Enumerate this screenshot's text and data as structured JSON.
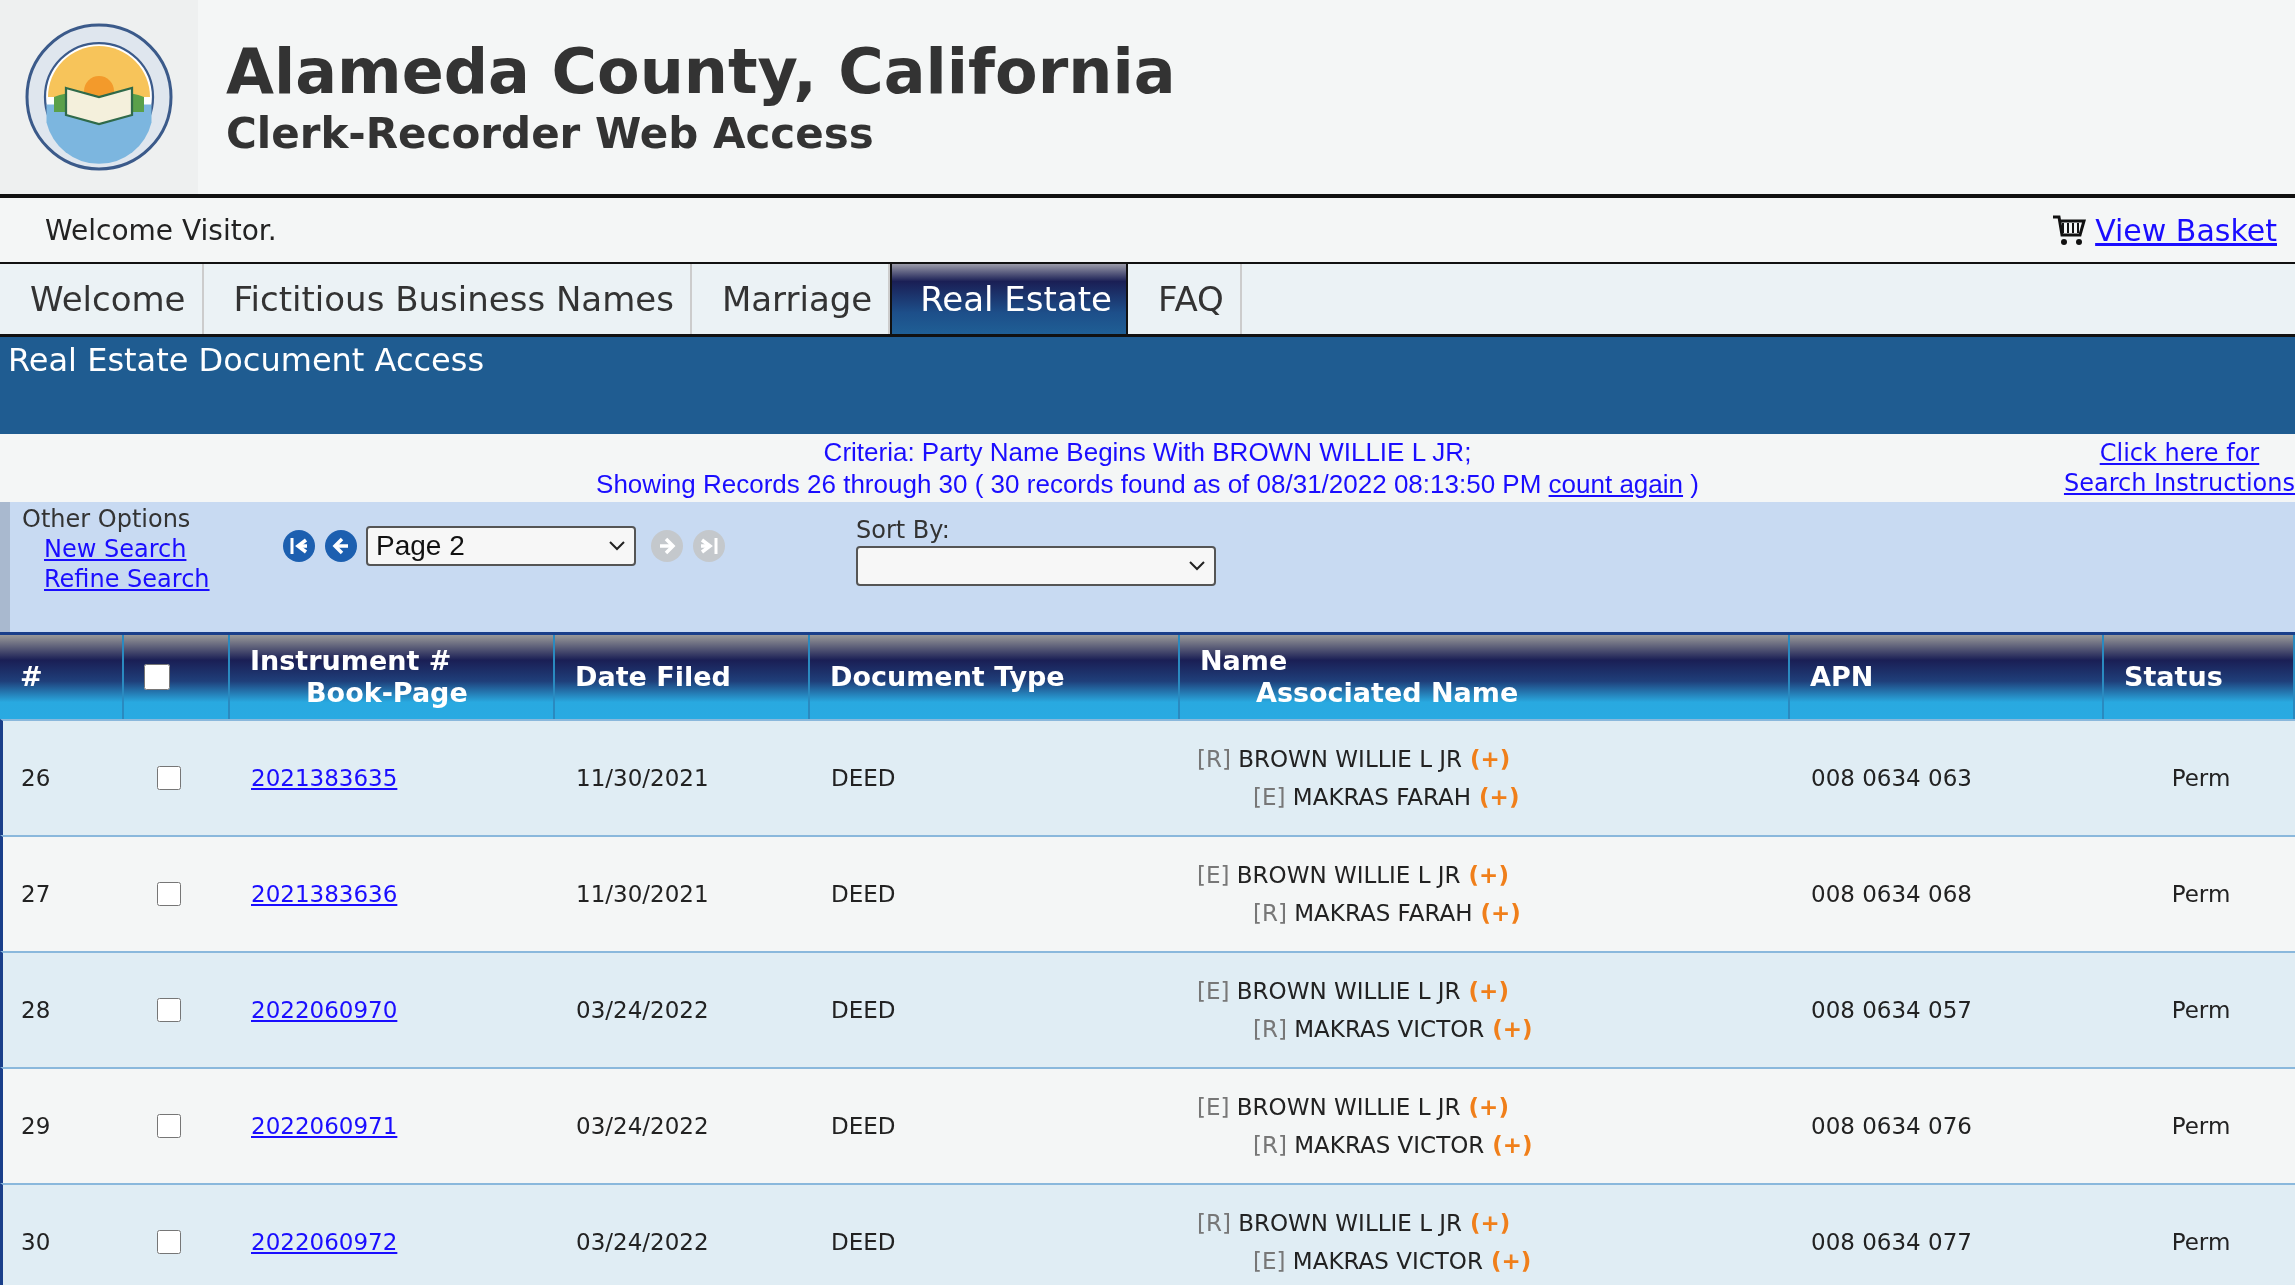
{
  "header": {
    "title": "Alameda County, California",
    "subtitle": "Clerk-Recorder Web Access"
  },
  "welcome": {
    "text": "Welcome Visitor.",
    "basket_link": "View Basket"
  },
  "tabs": [
    {
      "label": "Welcome",
      "selected": false
    },
    {
      "label": "Fictitious Business Names",
      "selected": false
    },
    {
      "label": "Marriage",
      "selected": false
    },
    {
      "label": "Real Estate",
      "selected": true
    },
    {
      "label": "FAQ",
      "selected": false
    }
  ],
  "section_title": "Real Estate Document Access",
  "criteria": {
    "line_1": "Criteria:  Party Name Begins With BROWN WILLIE L JR;",
    "line_2": "Showing Records 26 through 30 ( 30 records found as of 08/31/2022 08:13:50 PM",
    "count_link": "count again",
    "line_2_end": ")",
    "help_link_1": "Click here for",
    "help_link_2": "Search Instructions"
  },
  "options": {
    "heading": "Other Options",
    "links": [
      "New Search",
      "Refine Search"
    ],
    "page_select": "Page 2",
    "nav_buttons": [
      {
        "kind": "first",
        "disabled": false
      },
      {
        "kind": "prev",
        "disabled": false
      },
      {
        "kind": "next",
        "disabled": true
      },
      {
        "kind": "last",
        "disabled": true
      }
    ],
    "sort_label": "Sort By:"
  },
  "table": {
    "columns": [
      {
        "label": "#"
      },
      {
        "kind": "checkbox",
        "checked": false
      },
      {
        "label": "Instrument #",
        "label_2": "Book-Page"
      },
      {
        "label": "Date Filed"
      },
      {
        "label": "Document Type"
      },
      {
        "label": "Name",
        "label_2": "Associated Name"
      },
      {
        "label": "APN"
      },
      {
        "label": "Status"
      }
    ],
    "rows": [
      {
        "num": "26",
        "checked": false,
        "instrument": "2021383635",
        "date": "11/30/2021",
        "type": "DEED",
        "names": [
          {
            "role": "[R]",
            "name": "BROWN WILLIE L JR",
            "add": "(+)"
          },
          {
            "role": "[E]",
            "name": "MAKRAS FARAH",
            "add": "(+)"
          }
        ],
        "apn": "008 0634 063",
        "status": "Perm"
      },
      {
        "num": "27",
        "checked": false,
        "instrument": "2021383636",
        "date": "11/30/2021",
        "type": "DEED",
        "names": [
          {
            "role": "[E]",
            "name": "BROWN WILLIE L JR",
            "add": "(+)"
          },
          {
            "role": "[R]",
            "name": "MAKRAS FARAH",
            "add": "(+)"
          }
        ],
        "apn": "008 0634 068",
        "status": "Perm"
      },
      {
        "num": "28",
        "checked": false,
        "instrument": "2022060970",
        "date": "03/24/2022",
        "type": "DEED",
        "names": [
          {
            "role": "[E]",
            "name": "BROWN WILLIE L JR",
            "add": "(+)"
          },
          {
            "role": "[R]",
            "name": "MAKRAS VICTOR",
            "add": "(+)"
          }
        ],
        "apn": "008 0634 057",
        "status": "Perm"
      },
      {
        "num": "29",
        "checked": false,
        "instrument": "2022060971",
        "date": "03/24/2022",
        "type": "DEED",
        "names": [
          {
            "role": "[E]",
            "name": "BROWN WILLIE L JR",
            "add": "(+)"
          },
          {
            "role": "[R]",
            "name": "MAKRAS VICTOR",
            "add": "(+)"
          }
        ],
        "apn": "008 0634 076",
        "status": "Perm"
      },
      {
        "num": "30",
        "checked": false,
        "instrument": "2022060972",
        "date": "03/24/2022",
        "type": "DEED",
        "names": [
          {
            "role": "[R]",
            "name": "BROWN WILLIE L JR",
            "add": "(+)"
          },
          {
            "role": "[E]",
            "name": "MAKRAS VICTOR",
            "add": "(+)"
          }
        ],
        "apn": "008 0634 077",
        "status": "Perm"
      }
    ]
  }
}
